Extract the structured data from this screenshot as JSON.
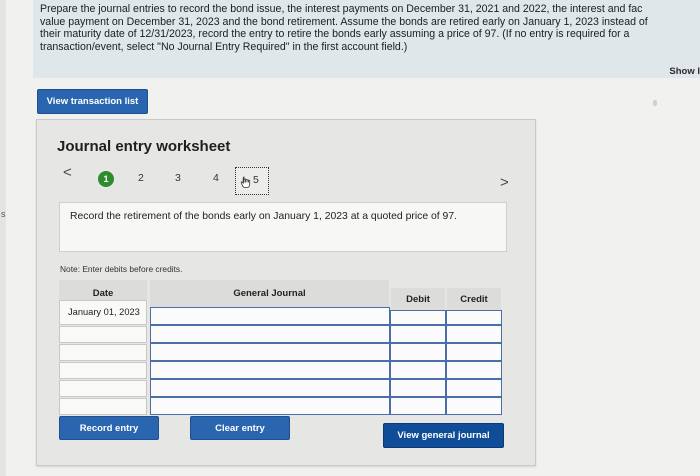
{
  "instructions": {
    "text": "Prepare the journal entries to record the bond issue, the interest payments on December 31, 2021 and 2022, the interest and fac\nvalue payment on December 31, 2023 and the bond retirement. Assume the bonds are retired early on January 1, 2023 instead of\ntheir maturity date of 12/31/2023, record the entry to retire the bonds early assuming a price of 97. (If no entry is required for a\ntransaction/event, select \"No Journal Entry Required\" in the first account field.)",
    "show_link": "Show l"
  },
  "edge_text": "s",
  "buttons": {
    "view_transaction_list": "View transaction list",
    "record_entry": "Record entry",
    "clear_entry": "Clear entry",
    "view_general_journal": "View general journal"
  },
  "worksheet": {
    "title": "Journal entry worksheet",
    "prev": "<",
    "next": ">",
    "steps": [
      "1",
      "2",
      "3",
      "4",
      "5"
    ],
    "active_step": "1",
    "current_step": "5",
    "prompt": "Record the retirement of the bonds early on January 1, 2023 at a quoted price of 97.",
    "note": "Note: Enter debits before credits."
  },
  "journal": {
    "headers": {
      "date": "Date",
      "account": "General Journal",
      "debit": "Debit",
      "credit": "Credit"
    },
    "rows": [
      {
        "date": "January 01, 2023",
        "account": "",
        "debit": "",
        "credit": ""
      },
      {
        "date": "",
        "account": "",
        "debit": "",
        "credit": ""
      },
      {
        "date": "",
        "account": "",
        "debit": "",
        "credit": ""
      },
      {
        "date": "",
        "account": "",
        "debit": "",
        "credit": ""
      },
      {
        "date": "",
        "account": "",
        "debit": "",
        "credit": ""
      },
      {
        "date": "",
        "account": "",
        "debit": "",
        "credit": ""
      }
    ]
  },
  "colors": {
    "primary_button": "#2a66b0",
    "dark_button": "#0f4d98",
    "step_active": "#2e8b2e"
  }
}
